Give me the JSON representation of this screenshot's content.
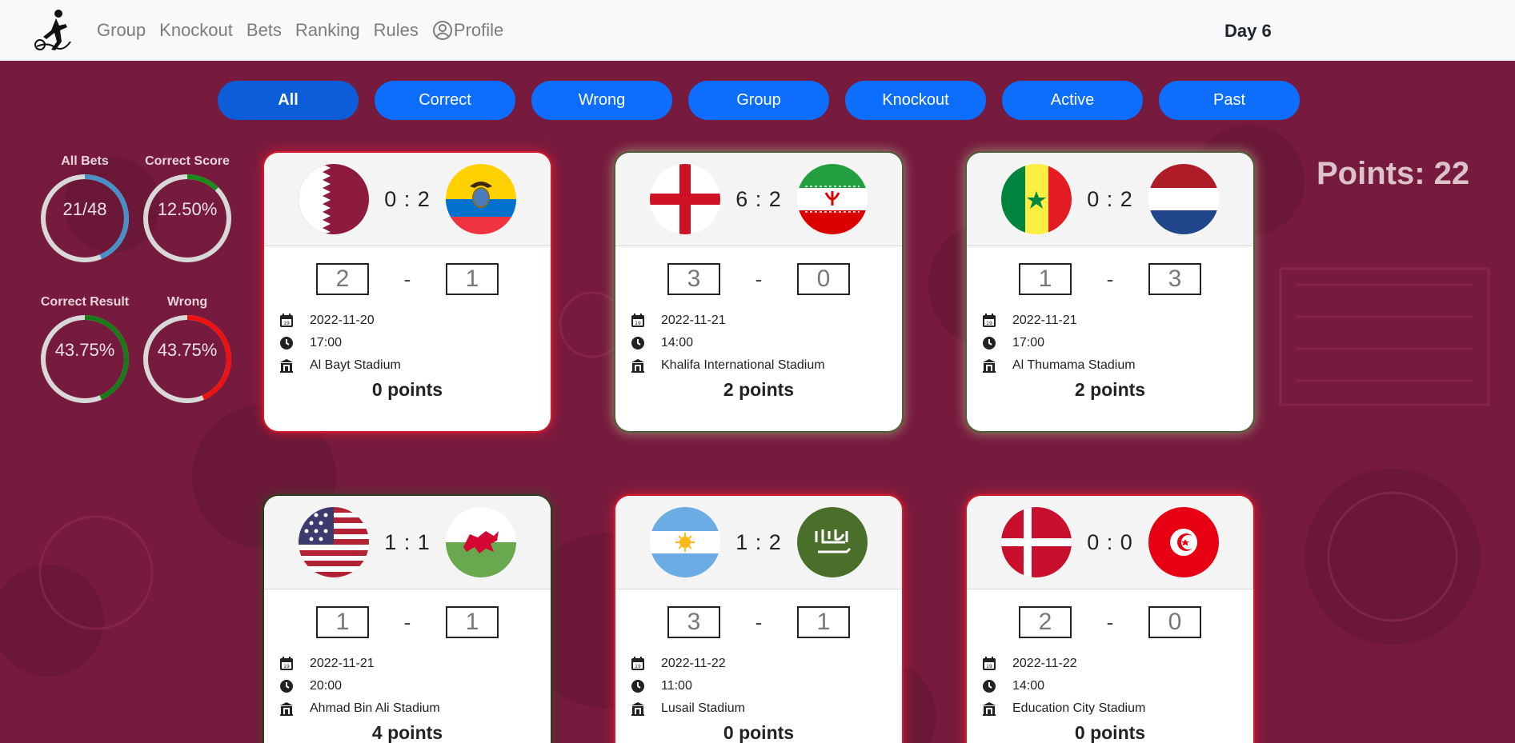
{
  "navbar": {
    "links": [
      "Group",
      "Knockout",
      "Bets",
      "Ranking",
      "Rules",
      "Profile"
    ],
    "day": "Day 6"
  },
  "filters": [
    "All",
    "Correct",
    "Wrong",
    "Group",
    "Knockout",
    "Active",
    "Past"
  ],
  "active_filter": "All",
  "stats": [
    {
      "label": "All Bets",
      "value": "21/48",
      "ratio": 0.4375,
      "color": "#4a90c8"
    },
    {
      "label": "Correct Score",
      "value": "12.50%",
      "ratio": 0.125,
      "color": "#1a8a1a"
    },
    {
      "label": "Correct Result",
      "value": "43.75%",
      "ratio": 0.4375,
      "color": "#1a7a1a"
    },
    {
      "label": "Wrong",
      "value": "43.75%",
      "ratio": 0.4375,
      "color": "#ee1111"
    }
  ],
  "points_total": "Points: 22",
  "matches": [
    {
      "home": "qatar",
      "away": "ecuador",
      "result": "0 : 2",
      "bet_home": "2",
      "bet_away": "1",
      "date": "2022-11-20",
      "time": "17:00",
      "stadium": "Al Bayt Stadium",
      "points": "0 points",
      "glow": "red"
    },
    {
      "home": "england",
      "away": "iran",
      "result": "6 : 2",
      "bet_home": "3",
      "bet_away": "0",
      "date": "2022-11-21",
      "time": "14:00",
      "stadium": "Khalifa International Stadium",
      "points": "2 points",
      "glow": "green"
    },
    {
      "home": "senegal",
      "away": "netherlands",
      "result": "0 : 2",
      "bet_home": "1",
      "bet_away": "3",
      "date": "2022-11-21",
      "time": "17:00",
      "stadium": "Al Thumama Stadium",
      "points": "2 points",
      "glow": "green"
    },
    {
      "home": "usa",
      "away": "wales",
      "result": "1 : 1",
      "bet_home": "1",
      "bet_away": "1",
      "date": "2022-11-21",
      "time": "20:00",
      "stadium": "Ahmad Bin Ali Stadium",
      "points": "4 points",
      "glow": "dark"
    },
    {
      "home": "argentina",
      "away": "saudi-arabia",
      "result": "1 : 2",
      "bet_home": "3",
      "bet_away": "1",
      "date": "2022-11-22",
      "time": "11:00",
      "stadium": "Lusail Stadium",
      "points": "0 points",
      "glow": "red"
    },
    {
      "home": "denmark",
      "away": "tunisia",
      "result": "0 : 0",
      "bet_home": "2",
      "bet_away": "0",
      "date": "2022-11-22",
      "time": "14:00",
      "stadium": "Education City Stadium",
      "points": "0 points",
      "glow": "red"
    }
  ],
  "icons": {
    "logo": "football-player-logo-icon",
    "profile": "user-circle-icon",
    "date": "calendar-icon",
    "time": "clock-icon",
    "stadium": "stadium-icon"
  }
}
